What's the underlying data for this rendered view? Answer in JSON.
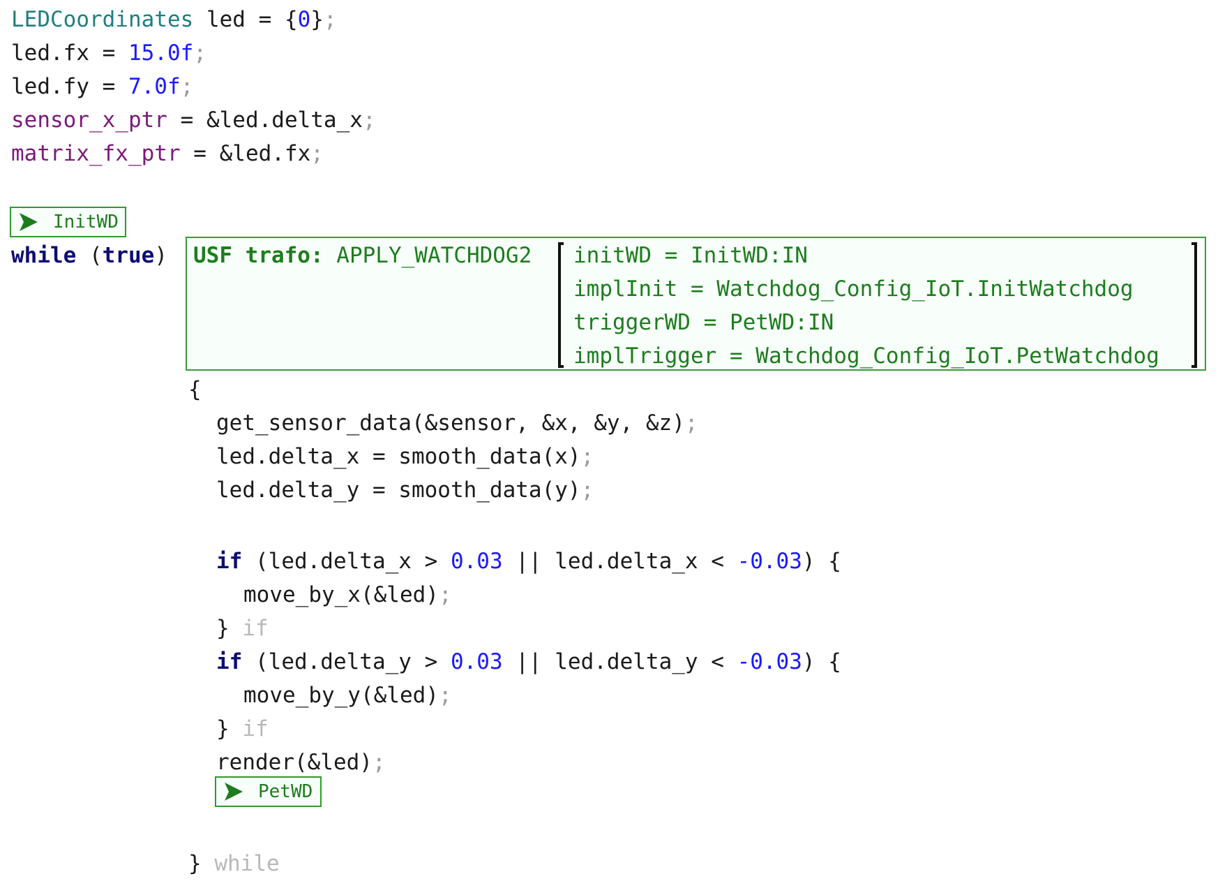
{
  "header_code": {
    "l1": {
      "type": "LEDCoordinates",
      "rest": " led = {",
      "num": "0",
      "close": "}",
      "semi": ";"
    },
    "l2": {
      "pre": "led.fx = ",
      "num": "15.0f",
      "semi": ";"
    },
    "l3": {
      "pre": "led.fy = ",
      "num": "7.0f",
      "semi": ";"
    },
    "l4": {
      "var": "sensor_x_ptr",
      "rest": " = &led.delta_x",
      "semi": ";"
    },
    "l5": {
      "var": "matrix_fx_ptr",
      "rest": " = &led.fx",
      "semi": ";"
    }
  },
  "markers": {
    "init": {
      "label": "InitWD",
      "icon": "play-arrow-icon"
    },
    "pet": {
      "label": "PetWD",
      "icon": "play-arrow-icon"
    }
  },
  "loop": {
    "kw_while": "while",
    "open_paren": " (",
    "kw_true": "true",
    "close_paren": ")",
    "open_brace": "{",
    "close_brace": "}",
    "close_label": " while"
  },
  "trafo": {
    "prefix": "USF trafo:",
    "name": " APPLY_WATCHDOG2",
    "params": [
      "initWD = InitWD:IN",
      "implInit = Watchdog_Config_IoT.InitWatchdog",
      "triggerWD = PetWD:IN",
      "implTrigger = Watchdog_Config_IoT.PetWatchdog"
    ]
  },
  "body": {
    "get": {
      "code": "get_sensor_data(&sensor, &x, &y, &z)",
      "semi": ";"
    },
    "dx": {
      "code": "led.delta_x = smooth_data(x)",
      "semi": ";"
    },
    "dy": {
      "code": "led.delta_y = smooth_data(y)",
      "semi": ";"
    },
    "if1": {
      "kw": "if",
      "a": " (led.delta_x > ",
      "n1": "0.03",
      "b": " || led.delta_x < ",
      "n2": "-0.03",
      "c": ") {"
    },
    "move_x": {
      "code": "move_by_x(&led)",
      "semi": ";"
    },
    "end_if1": {
      "brace": "}",
      "label": " if"
    },
    "if2": {
      "kw": "if",
      "a": " (led.delta_y > ",
      "n1": "0.03",
      "b": " || led.delta_y < ",
      "n2": "-0.03",
      "c": ") {"
    },
    "move_y": {
      "code": "move_by_y(&led)",
      "semi": ";"
    },
    "end_if2": {
      "brace": "}",
      "label": " if"
    },
    "render": {
      "code": "render(&led)",
      "semi": ";"
    }
  },
  "colors": {
    "type": "#1f7f7f",
    "number": "#1a1aff",
    "variable": "#7a1a7a",
    "keyword": "#0d0d73",
    "annotation": "#1d7d1d",
    "dim": "#b8b8b8"
  }
}
